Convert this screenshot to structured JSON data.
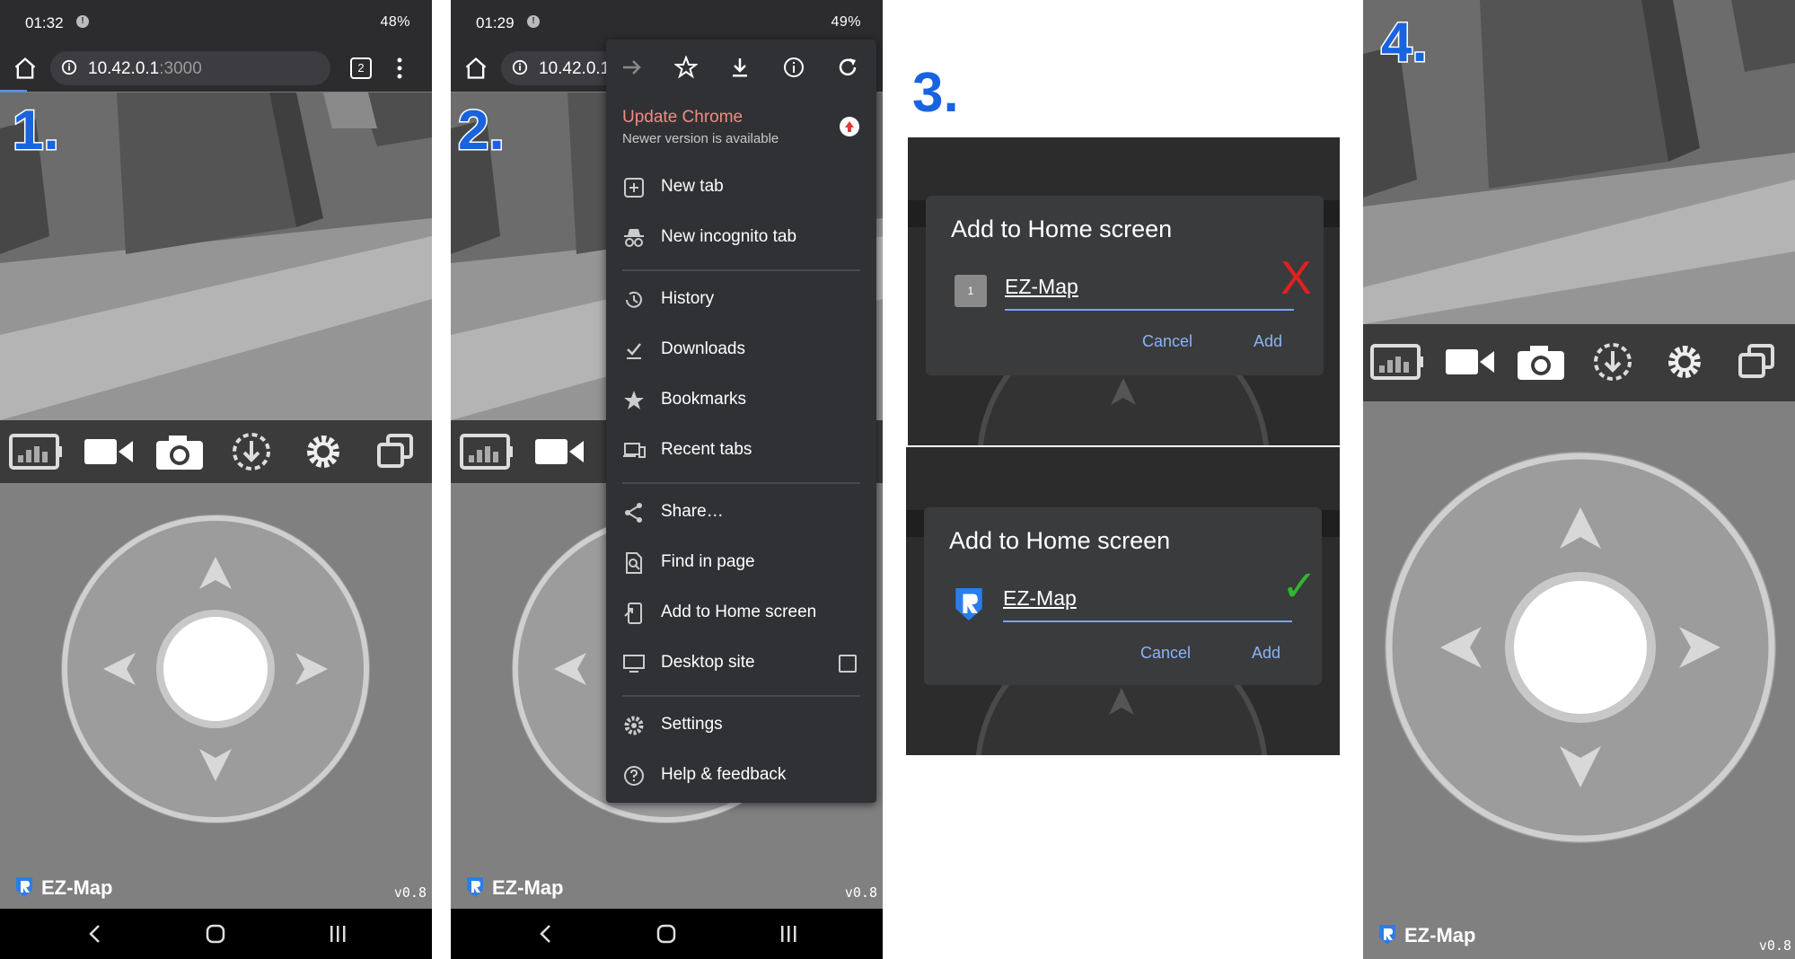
{
  "steps": [
    "1.",
    "2.",
    "3.",
    "4."
  ],
  "phone1": {
    "status_time": "01:32",
    "status_right": "48%",
    "url_host": "10.42.0.1",
    "url_port": ":3000",
    "tab_count": "2"
  },
  "phone2": {
    "status_time": "01:29",
    "status_right": "49%",
    "url_host_truncated": "10.42.0.1"
  },
  "app": {
    "brand": "EZ-Map",
    "version": "v0.8",
    "toolbar_icons": [
      "battery-bars-icon",
      "video-camera-icon",
      "camera-icon",
      "download-circle-icon",
      "gear-icon",
      "copy-icon"
    ]
  },
  "chrome_menu": {
    "top_icons": [
      "forward-icon",
      "star-icon",
      "download-icon",
      "info-icon",
      "refresh-icon"
    ],
    "update_title": "Update Chrome",
    "update_subtitle": "Newer version is available",
    "items": [
      {
        "label": "New tab",
        "icon": "new-tab-icon"
      },
      {
        "label": "New incognito tab",
        "icon": "incognito-icon"
      },
      {
        "label": "History",
        "icon": "history-icon"
      },
      {
        "label": "Downloads",
        "icon": "downloads-icon"
      },
      {
        "label": "Bookmarks",
        "icon": "bookmark-star-icon"
      },
      {
        "label": "Recent tabs",
        "icon": "devices-icon"
      },
      {
        "label": "Share…",
        "icon": "share-icon"
      },
      {
        "label": "Find in page",
        "icon": "find-icon"
      },
      {
        "label": "Add to Home screen",
        "icon": "add-home-icon"
      },
      {
        "label": "Desktop site",
        "icon": "monitor-icon"
      },
      {
        "label": "Settings",
        "icon": "settings-icon"
      },
      {
        "label": "Help & feedback",
        "icon": "help-icon"
      }
    ]
  },
  "dialog_bad": {
    "title": "Add to Home screen",
    "app_name": "EZ-Map",
    "icon_letter": "1",
    "cancel": "Cancel",
    "add": "Add",
    "mark": "X"
  },
  "dialog_good": {
    "title": "Add to Home screen",
    "app_name": "EZ-Map",
    "cancel": "Cancel",
    "add": "Add",
    "mark": "✓"
  },
  "colors": {
    "step_number": "#1a63e0",
    "mark_bad": "#e02020",
    "mark_good": "#2eb82e",
    "update_chrome": "#f28b82",
    "dialog_button": "#8ab4f8"
  }
}
